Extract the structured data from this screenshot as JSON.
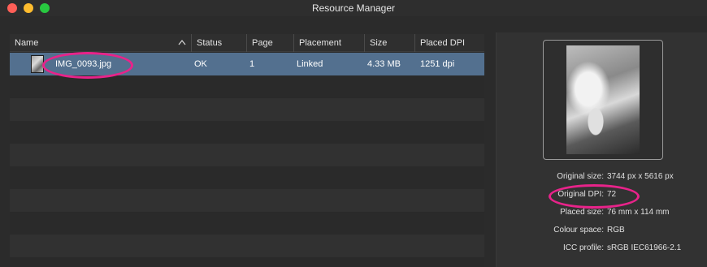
{
  "window": {
    "title": "Resource Manager"
  },
  "table": {
    "columns": [
      "Name",
      "Status",
      "Page",
      "Placement",
      "Size",
      "Placed DPI"
    ],
    "rows": [
      {
        "name": "IMG_0093.jpg",
        "status": "OK",
        "page": "1",
        "placement": "Linked",
        "size": "4.33 MB",
        "placed_dpi": "1251 dpi"
      }
    ]
  },
  "details": {
    "original_size_label": "Original size:",
    "original_size": "3744 px x 5616 px",
    "original_dpi_label": "Original DPI:",
    "original_dpi": "72",
    "placed_size_label": "Placed size:",
    "placed_size": "76 mm x 114 mm",
    "colour_space_label": "Colour space:",
    "colour_space": "RGB",
    "icc_profile_label": "ICC profile:",
    "icc_profile": "sRGB IEC61966-2.1"
  },
  "icons": {
    "sort": "chevron-up-icon",
    "thumbnail": "image-thumbnail-icon"
  },
  "colors": {
    "selection": "#53708f",
    "highlight_mark": "#e8238a",
    "close": "#ff5f57",
    "minimize": "#febc2e",
    "maximize": "#28c840"
  }
}
